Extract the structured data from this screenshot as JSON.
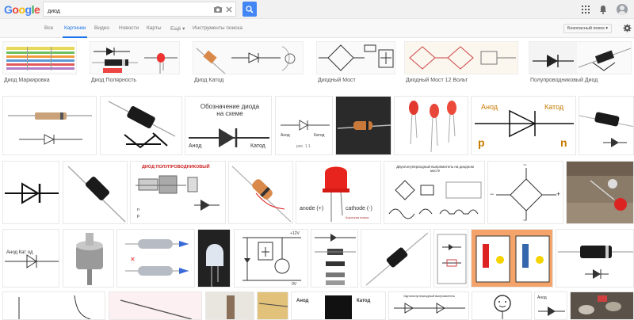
{
  "header": {
    "logo_letters": [
      "G",
      "o",
      "o",
      "g",
      "l",
      "e"
    ],
    "logo_colors": [
      "#4285f4",
      "#ea4335",
      "#fbbc05",
      "#4285f4",
      "#34a853",
      "#ea4335"
    ],
    "search_value": "диод",
    "accent": "#4285f4"
  },
  "tabs": [
    {
      "label": "Все",
      "active": false
    },
    {
      "label": "Картинки",
      "active": true
    },
    {
      "label": "Видео",
      "active": false
    },
    {
      "label": "Новости",
      "active": false
    },
    {
      "label": "Карты",
      "active": false
    },
    {
      "label": "Ещё ▾",
      "active": false
    },
    {
      "label": "Инструменты поиска",
      "active": false
    }
  ],
  "safesearch": {
    "label": "Безопасный поиск ▾"
  },
  "related": [
    {
      "label": "Диод Маркировка"
    },
    {
      "label": "Диод Полярность"
    },
    {
      "label": "Диод Катод"
    },
    {
      "label": "Диодный Мост"
    },
    {
      "label": "Диодный Мост 12 Вольт"
    },
    {
      "label": "Полупроводниковый Диод"
    }
  ],
  "thumbs_text": {
    "anode_ru": "Анод",
    "cathode_ru": "Катод",
    "p": "p",
    "n": "n",
    "designation_title": "Обозначение диода на схеме",
    "anode_en": "anode (+)",
    "cathode_en": "cathode (-)",
    "semiconductor_title": "ДИОД ПОЛУПРОВОДНИКОВЫЙ",
    "bridge_title": "Двухполупериодный выпрямитель на диодном мосте",
    "rectifier_title": "Однополупериодный выпрямитель",
    "anod_cat": "Анод    Кат од",
    "v12": "+12V",
    "v0": "0V",
    "fig": "рис. 1.1",
    "short_leg": "Короткая ножка",
    "tilde": "~",
    "plus": "+",
    "minus": "−"
  }
}
